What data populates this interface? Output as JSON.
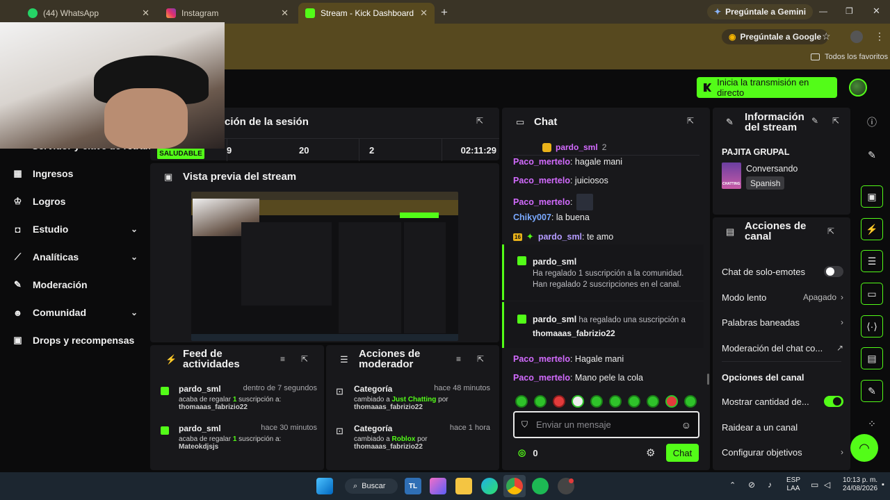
{
  "browser": {
    "tabs": [
      {
        "label": "(44) WhatsApp",
        "icon": "whatsapp-icon"
      },
      {
        "label": "Instagram",
        "icon": "instagram-icon"
      },
      {
        "label": "Stream - Kick Dashboard",
        "icon": "kick-icon"
      }
    ],
    "gemini_label": "Pregúntale a Gemini",
    "google_label": "Pregúntale a Google",
    "bookmarks_label": "Todos los favoritos"
  },
  "header": {
    "golive_label": "Inicia la transmisión en directo"
  },
  "sidebar": {
    "partial_label": "Servidor y clave de retrans",
    "items": [
      {
        "label": "Ingresos",
        "icon": "dollar-icon",
        "chevron": false
      },
      {
        "label": "Logros",
        "icon": "trophy-icon",
        "chevron": false
      },
      {
        "label": "Estudio",
        "icon": "camera-icon",
        "chevron": true
      },
      {
        "label": "Analíticas",
        "icon": "chart-icon",
        "chevron": true
      },
      {
        "label": "Moderación",
        "icon": "wrench-icon",
        "chevron": false
      },
      {
        "label": "Comunidad",
        "icon": "people-icon",
        "chevron": true
      },
      {
        "label": "Drops y recompensas",
        "icon": "gift-icon",
        "chevron": false
      }
    ]
  },
  "session": {
    "title": "ción de la sesión",
    "status": "SALUDABLE",
    "stats": [
      "9",
      "20",
      "2",
      "02:11:29"
    ]
  },
  "preview": {
    "title": "Vista previa del stream"
  },
  "feed": {
    "title_l1": "Feed de",
    "title_l2": "actividades",
    "items": [
      {
        "user": "pardo_sml",
        "time": "dentro de 7 segundos",
        "pre": "acaba de regalar ",
        "count": "1",
        "post": " suscripción a:",
        "target": "thomaaas_fabrizio22"
      },
      {
        "user": "pardo_sml",
        "time": "hace 30 minutos",
        "pre": "acaba de regalar ",
        "count": "1",
        "post": " suscripción a:",
        "target": "Mateokdjsjs"
      }
    ]
  },
  "mod": {
    "title_l1": "Acciones de",
    "title_l2": "moderador",
    "items": [
      {
        "title": "Categoría",
        "time": "hace 48 minutos",
        "pre": "cambiado a ",
        "cat": "Just Chatting",
        "by": " por",
        "user": "thomaaas_fabrizio22"
      },
      {
        "title": "Categoría",
        "time": "hace 1 hora",
        "pre": "cambiado a ",
        "cat": "Roblox",
        "by": " por",
        "user": "thomaaas_fabrizio22"
      }
    ]
  },
  "chat": {
    "title": "Chat",
    "pinned_user": "pardo_sml",
    "pinned_count": "2",
    "messages": [
      {
        "user": "Paco_mertelo",
        "text": ": hagale mani"
      },
      {
        "user": "Paco_mertelo",
        "text": ": juiciosos"
      },
      {
        "user": "Paco_mertelo",
        "text": ":"
      },
      {
        "user": "Chiky007",
        "text": ": la buena"
      },
      {
        "user": "pardo_sml",
        "text": ": te amo",
        "badge": "16"
      },
      {
        "user": "Paco_mertelo",
        "text": ": Hagale mani"
      },
      {
        "user": "Paco_mertelo",
        "text": ": Mano pele la cola"
      }
    ],
    "gift1": {
      "user": "pardo_sml",
      "l1": "Ha regalado 1 suscripción a la comunidad.",
      "l2": "Han regalado 2 suscripciones en el canal."
    },
    "gift2": {
      "user": "pardo_sml",
      "mid": " ha regalado una suscripción a",
      "target": "thomaaas_fabrizio22"
    },
    "input_placeholder": "Enviar un mensaje",
    "points": "0",
    "send_label": "Chat"
  },
  "info": {
    "title_l1": "Información",
    "title_l2": "del stream",
    "stream_title": "PAJITA GRUPAL",
    "category": "Conversando",
    "language": "Spanish",
    "thumb_text": "CHATTING"
  },
  "actions": {
    "title_l1": "Acciones de",
    "title_l2": "canal",
    "emote_only": "Chat de solo-emotes",
    "slow_mode": "Modo lento",
    "slow_value": "Apagado",
    "banned_words": "Palabras baneadas",
    "chat_mod": "Moderación del chat co...",
    "channel_options": "Opciones del canal",
    "show_count": "Mostrar cantidad de...",
    "raid": "Raidear a un canal",
    "goals": "Configurar objetivos"
  },
  "taskbar": {
    "search_label": "Buscar",
    "lang1": "ESP",
    "lang2": "LAA",
    "time": "10:13 p. m.",
    "date": "24/08/2026"
  },
  "colors": {
    "accent": "#53fc18",
    "panel": "#18181b",
    "background": "#0b0b0c"
  }
}
